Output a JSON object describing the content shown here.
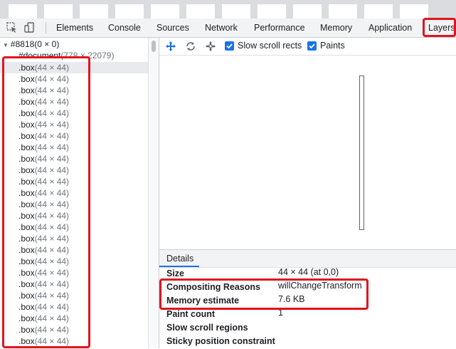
{
  "devtools": {
    "tabs": [
      "Elements",
      "Console",
      "Sources",
      "Network",
      "Performance",
      "Memory",
      "Application",
      "Layers"
    ],
    "active_tab": "Layers"
  },
  "layers_tree": {
    "root": {
      "name": "#8818",
      "size": "(0 × 0)"
    },
    "document": {
      "name": "#document",
      "size": "(778 × 22079)"
    },
    "rows": [
      {
        "name": ".box",
        "size": "(44 × 44)"
      },
      {
        "name": ".box",
        "size": "(44 × 44)"
      },
      {
        "name": ".box",
        "size": "(44 × 44)"
      },
      {
        "name": ".box",
        "size": "(44 × 44)"
      },
      {
        "name": ".box",
        "size": "(44 × 44)"
      },
      {
        "name": ".box",
        "size": "(44 × 44)"
      },
      {
        "name": ".box",
        "size": "(44 × 44)"
      },
      {
        "name": ".box",
        "size": "(44 × 44)"
      },
      {
        "name": ".box",
        "size": "(44 × 44)"
      },
      {
        "name": ".box",
        "size": "(44 × 44)"
      },
      {
        "name": ".box",
        "size": "(44 × 44)"
      },
      {
        "name": ".box",
        "size": "(44 × 44)"
      },
      {
        "name": ".box",
        "size": "(44 × 44)"
      },
      {
        "name": ".box",
        "size": "(44 × 44)"
      },
      {
        "name": ".box",
        "size": "(44 × 44)"
      },
      {
        "name": ".box",
        "size": "(44 × 44)"
      },
      {
        "name": ".box",
        "size": "(44 × 44)"
      },
      {
        "name": ".box",
        "size": "(44 × 44)"
      },
      {
        "name": ".box",
        "size": "(44 × 44)"
      },
      {
        "name": ".box",
        "size": "(44 × 44)"
      },
      {
        "name": ".box",
        "size": "(44 × 44)"
      },
      {
        "name": ".box",
        "size": "(44 × 44)"
      },
      {
        "name": ".box",
        "size": "(44 × 44)"
      },
      {
        "name": ".box",
        "size": "(44 × 44)"
      },
      {
        "name": ".box",
        "size": "(44 × 44)"
      }
    ]
  },
  "layers_toolbar": {
    "slow_scroll_rects": {
      "label": "Slow scroll rects",
      "checked": true
    },
    "paints": {
      "label": "Paints",
      "checked": true
    }
  },
  "details": {
    "tab_label": "Details",
    "properties": [
      {
        "label": "Size",
        "value": "44 × 44 (at 0,0)"
      },
      {
        "label": "Compositing Reasons",
        "value": "willChangeTransform"
      },
      {
        "label": "Memory estimate",
        "value": "7.6 KB"
      },
      {
        "label": "Paint count",
        "value": "1"
      },
      {
        "label": "Slow scroll regions",
        "value": ""
      },
      {
        "label": "Sticky position constraint",
        "value": ""
      }
    ]
  },
  "colors": {
    "highlight_red": "#e0141e",
    "checkbox_blue": "#1a73e8"
  }
}
